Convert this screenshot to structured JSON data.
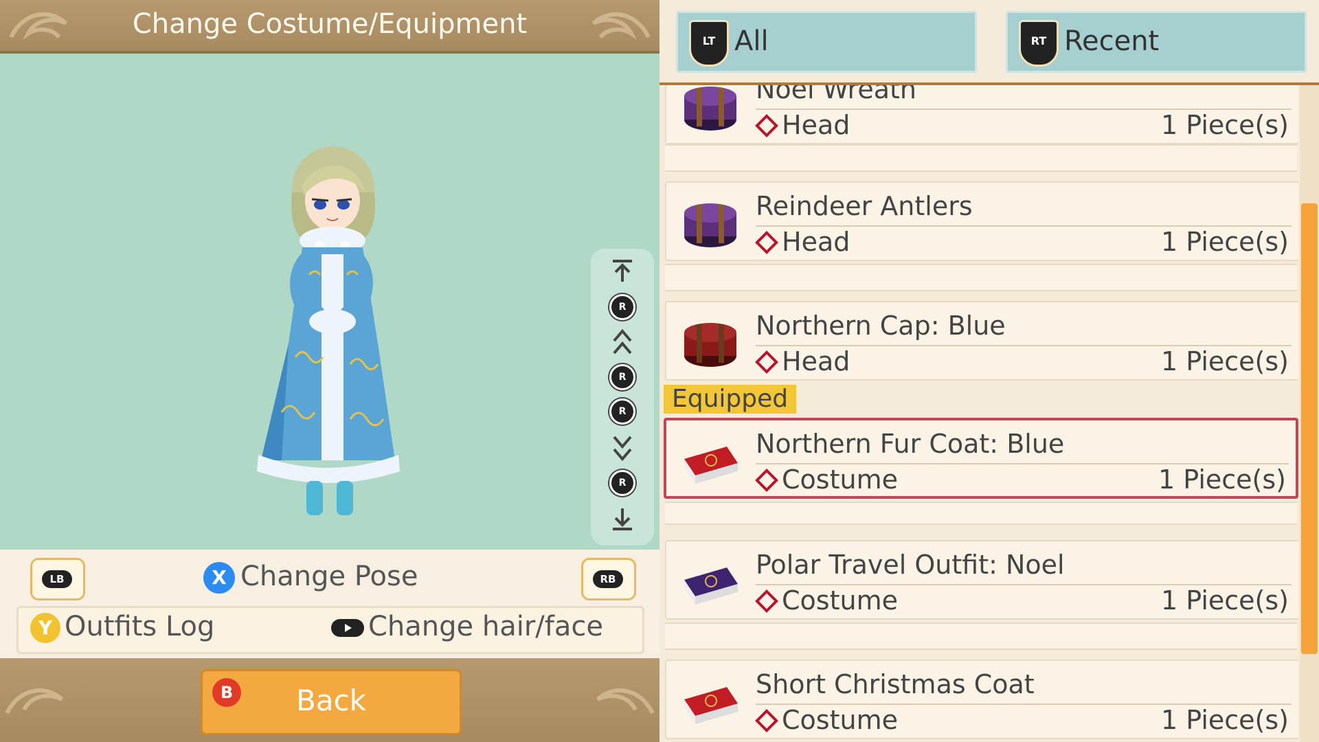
{
  "title": "Change Costume/Equipment",
  "controls": {
    "lb": "LB",
    "rb": "RB",
    "x_glyph": "X",
    "change_pose": "Change Pose",
    "y_glyph": "Y",
    "outfits_log": "Outfits Log",
    "change_hair_face": "Change hair/face",
    "b_glyph": "B",
    "back": "Back",
    "r_glyph": "R"
  },
  "tabs": [
    {
      "badge": "LT",
      "label": "All"
    },
    {
      "badge": "RT",
      "label": "Recent"
    }
  ],
  "equipped_label": "Equipped",
  "items": [
    {
      "name": "Noel Wreath",
      "category": "Head",
      "qty": "1 Piece(s)",
      "icon": "hat-box-purple-icon",
      "color": "#5b2f7a"
    },
    {
      "name": "Reindeer Antlers",
      "category": "Head",
      "qty": "1 Piece(s)",
      "icon": "hat-box-purple-icon",
      "color": "#5b2f7a"
    },
    {
      "name": "Northern Cap: Blue",
      "category": "Head",
      "qty": "1 Piece(s)",
      "icon": "hat-box-red-icon",
      "color": "#8a1a1a"
    },
    {
      "name": "Northern Fur Coat: Blue",
      "category": "Costume",
      "qty": "1 Piece(s)",
      "icon": "costume-case-red-icon",
      "color": "#a8141c"
    },
    {
      "name": "Polar Travel Outfit: Noel",
      "category": "Costume",
      "qty": "1 Piece(s)",
      "icon": "costume-case-purple-icon",
      "color": "#3e2470"
    },
    {
      "name": "Short Christmas Coat",
      "category": "Costume",
      "qty": "1 Piece(s)",
      "icon": "costume-case-red-icon",
      "color": "#a8141c"
    }
  ],
  "colors": {
    "accent": "#f4a23a",
    "selected_border": "#c0455d",
    "stage": "#b0d8c6",
    "title_bar": "#b79970"
  }
}
